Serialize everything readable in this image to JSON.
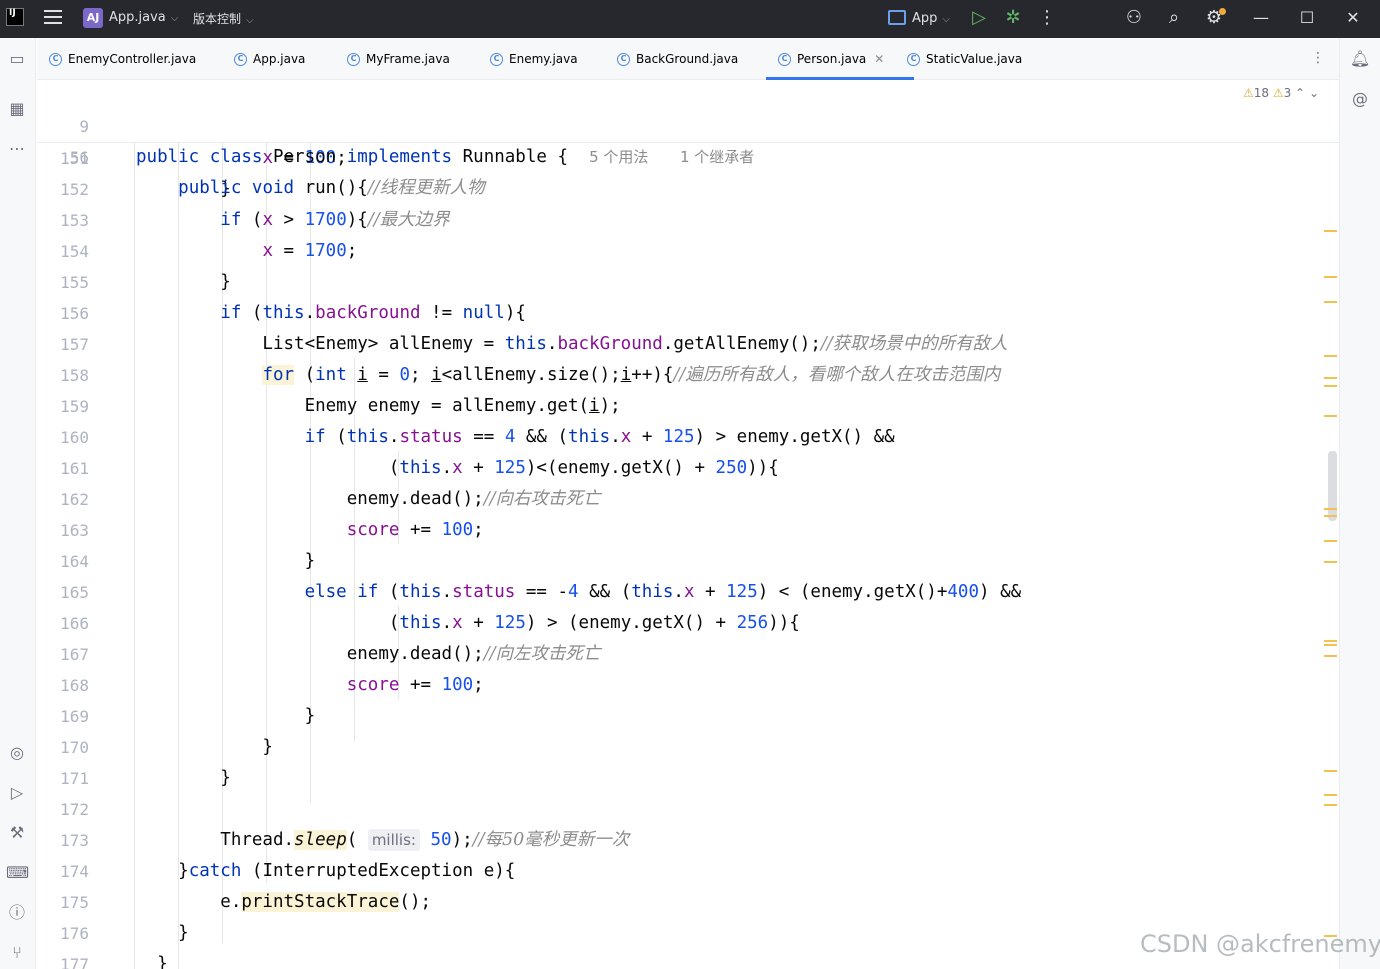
{
  "titlebar": {
    "logo": "IJ",
    "project_badge": "AJ",
    "project_name": "App.java",
    "vcs_label": "版本控制",
    "run_config": "App"
  },
  "tabs": [
    {
      "label": "EnemyController.java",
      "active": false
    },
    {
      "label": "App.java",
      "active": false
    },
    {
      "label": "MyFrame.java",
      "active": false
    },
    {
      "label": "Enemy.java",
      "active": false
    },
    {
      "label": "BackGround.java",
      "active": false
    },
    {
      "label": "Person.java",
      "active": true
    },
    {
      "label": "StaticValue.java",
      "active": false
    }
  ],
  "inspection": {
    "warnings": "18",
    "weak_warnings": "3"
  },
  "sticky": {
    "line9": {
      "num": "9",
      "usages": "5 个用法",
      "inheritors": "1 个继承者"
    },
    "line56": {
      "num": "56",
      "comment": "//线程更新人物"
    }
  },
  "lines": {
    "n151": "151",
    "n152": "152",
    "n153": "153",
    "n154": "154",
    "n155": "155",
    "n156": "156",
    "n157": "157",
    "n158": "158",
    "n159": "159",
    "n160": "160",
    "n161": "161",
    "n162": "162",
    "n163": "163",
    "n164": "164",
    "n165": "165",
    "n166": "166",
    "n167": "167",
    "n168": "168",
    "n169": "169",
    "n170": "170",
    "n171": "171",
    "n172": "172",
    "n173": "173",
    "n174": "174",
    "n175": "175",
    "n176": "176",
    "n177": "177"
  },
  "comments": {
    "c153": "//最大边界",
    "c157": "//获取场景中的所有敌人",
    "c158": "//遍历所有敌人，看哪个敌人在攻击范围内",
    "c162": "//向右攻击死亡",
    "c167": "//向左攻击死亡",
    "c173": "//每50毫秒更新一次"
  },
  "hint": {
    "millis": "millis:"
  },
  "watermark": "CSDN @akcfrenemy",
  "colors": {
    "keyword": "#0033b3",
    "field": "#871094",
    "number": "#1750eb",
    "comment": "#8c8c8c",
    "accent": "#3574f0"
  }
}
